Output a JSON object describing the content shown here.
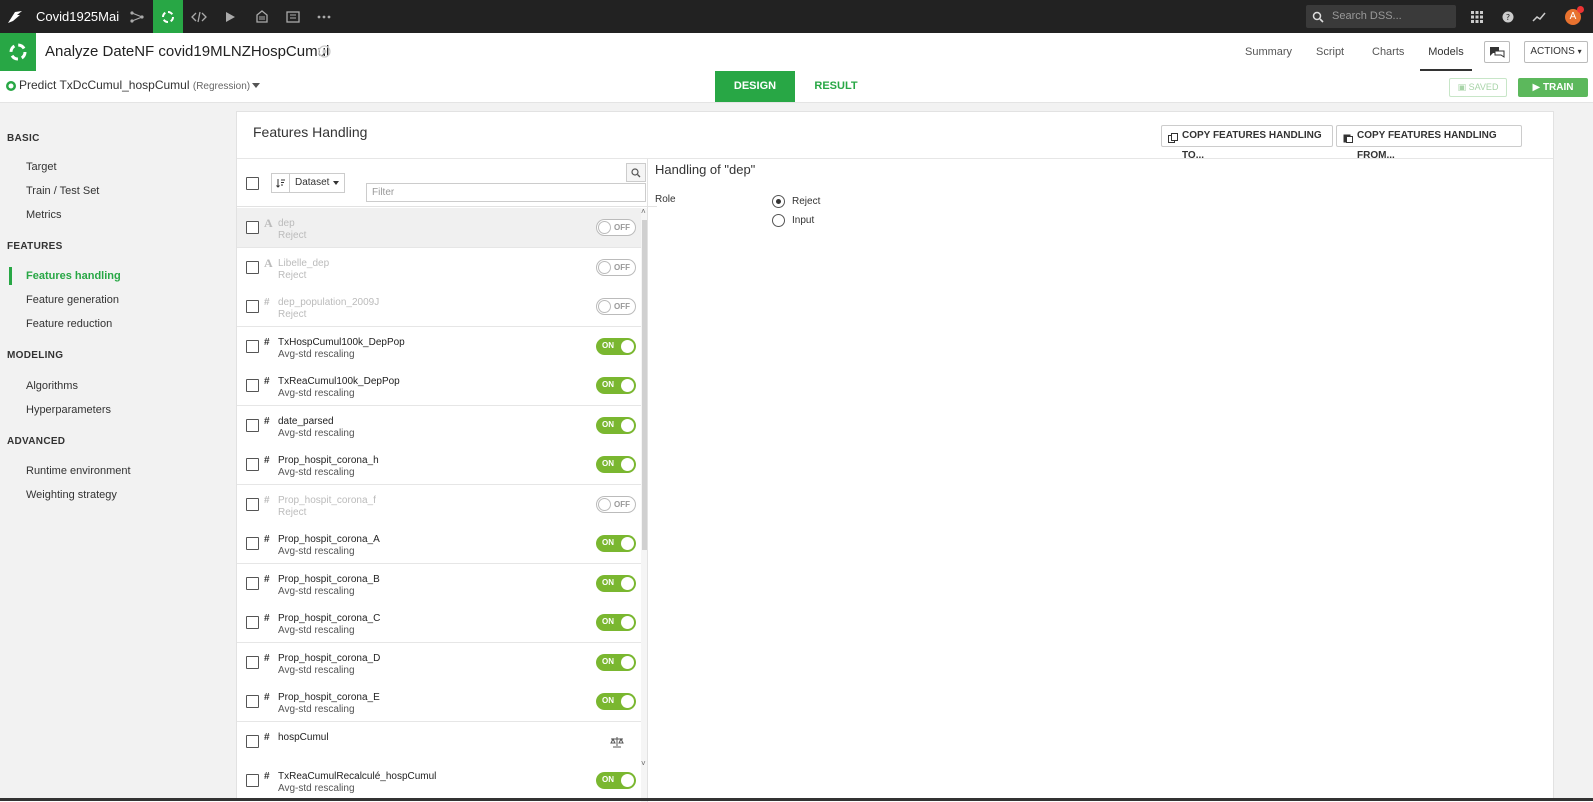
{
  "topbar": {
    "project_name": "Covid1925Mai",
    "search_placeholder": "Search DSS...",
    "avatar_letter": "A"
  },
  "header": {
    "title": "Analyze DateNF covid19MLNZHospCumul",
    "nav": [
      "Summary",
      "Script",
      "Charts",
      "Models"
    ],
    "active_nav": "Models",
    "actions_label": "ACTIONS"
  },
  "subheader": {
    "predict_label": "Predict TxDcCumul_hospCumul",
    "predict_type": "(Regression)",
    "tab_design": "DESIGN",
    "tab_result": "RESULT",
    "saved_label": "SAVED",
    "train_label": "TRAIN"
  },
  "sidebar": {
    "sections": [
      {
        "title": "BASIC",
        "items": [
          "Target",
          "Train / Test Set",
          "Metrics"
        ]
      },
      {
        "title": "FEATURES",
        "items": [
          "Features handling",
          "Feature generation",
          "Feature reduction"
        ]
      },
      {
        "title": "MODELING",
        "items": [
          "Algorithms",
          "Hyperparameters"
        ]
      },
      {
        "title": "ADVANCED",
        "items": [
          "Runtime environment",
          "Weighting strategy"
        ]
      }
    ],
    "active_item": "Features handling"
  },
  "panel": {
    "title": "Features Handling",
    "copy_to_label": "COPY FEATURES HANDLING TO...",
    "copy_from_label": "COPY FEATURES HANDLING FROM...",
    "dataset_label": "Dataset",
    "filter_placeholder": "Filter"
  },
  "features": [
    {
      "type": "A",
      "name": "dep",
      "handling": "Reject",
      "state": "off"
    },
    {
      "type": "A",
      "name": "Libelle_dep",
      "handling": "Reject",
      "state": "off"
    },
    {
      "type": "#",
      "name": "dep_population_2009J",
      "handling": "Reject",
      "state": "off"
    },
    {
      "type": "#",
      "name": "TxHospCumul100k_DepPop",
      "handling": "Avg-std rescaling",
      "state": "on"
    },
    {
      "type": "#",
      "name": "TxReaCumul100k_DepPop",
      "handling": "Avg-std rescaling",
      "state": "on"
    },
    {
      "type": "#",
      "name": "date_parsed",
      "handling": "Avg-std rescaling",
      "state": "on"
    },
    {
      "type": "#",
      "name": "Prop_hospit_corona_h",
      "handling": "Avg-std rescaling",
      "state": "on"
    },
    {
      "type": "#",
      "name": "Prop_hospit_corona_f",
      "handling": "Reject",
      "state": "off"
    },
    {
      "type": "#",
      "name": "Prop_hospit_corona_A",
      "handling": "Avg-std rescaling",
      "state": "on"
    },
    {
      "type": "#",
      "name": "Prop_hospit_corona_B",
      "handling": "Avg-std rescaling",
      "state": "on"
    },
    {
      "type": "#",
      "name": "Prop_hospit_corona_C",
      "handling": "Avg-std rescaling",
      "state": "on"
    },
    {
      "type": "#",
      "name": "Prop_hospit_corona_D",
      "handling": "Avg-std rescaling",
      "state": "on"
    },
    {
      "type": "#",
      "name": "Prop_hospit_corona_E",
      "handling": "Avg-std rescaling",
      "state": "on"
    },
    {
      "type": "#",
      "name": "hospCumul",
      "handling": "",
      "state": "weight"
    },
    {
      "type": "#",
      "name": "TxReaCumulRecalculé_hospCumul",
      "handling": "Avg-std rescaling",
      "state": "on"
    }
  ],
  "toggle_labels": {
    "on": "ON",
    "off": "OFF"
  },
  "detail": {
    "title": "Handling of \"dep\"",
    "role_label": "Role",
    "role_options": [
      "Reject",
      "Input"
    ],
    "role_selected": "Reject"
  },
  "colors": {
    "accent": "#28a745",
    "toggle_on": "#7ab730",
    "topbar": "#222222"
  }
}
